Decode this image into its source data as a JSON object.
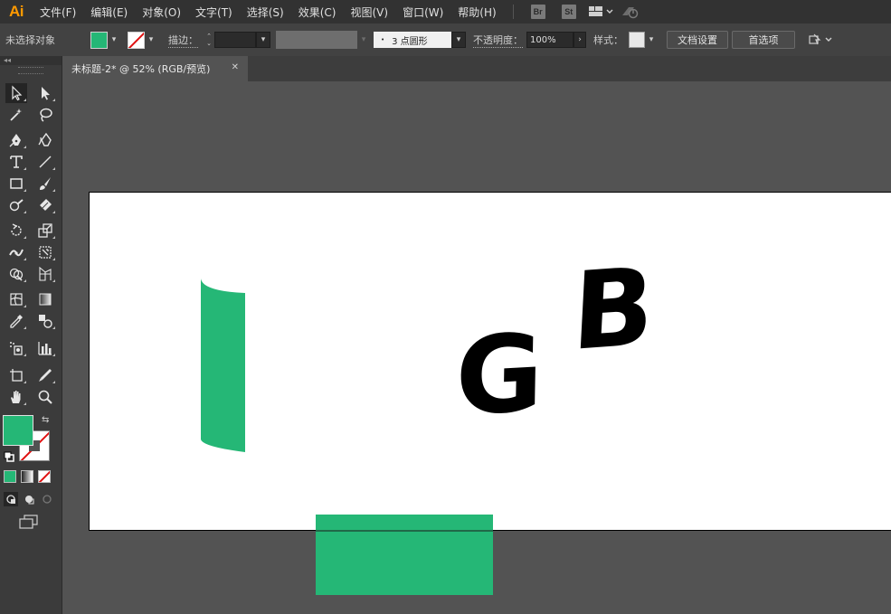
{
  "app": {
    "logo": "Ai"
  },
  "menu": [
    {
      "label": "文件(F)"
    },
    {
      "label": "编辑(E)"
    },
    {
      "label": "对象(O)"
    },
    {
      "label": "文字(T)"
    },
    {
      "label": "选择(S)"
    },
    {
      "label": "效果(C)"
    },
    {
      "label": "视图(V)"
    },
    {
      "label": "窗口(W)"
    },
    {
      "label": "帮助(H)"
    }
  ],
  "menu_apps": {
    "bridge": "Br",
    "stock": "St"
  },
  "control": {
    "selection_status": "未选择对象",
    "stroke_label": "描边：",
    "brush_label": "3 点圆形",
    "opacity_label": "不透明度：",
    "opacity_value": "100%",
    "style_label": "样式：",
    "doc_setup_button": "文档设置",
    "preferences_button": "首选项"
  },
  "document": {
    "tab_title": "未标题-2* @ 52% (RGB/预览)"
  },
  "canvas": {
    "letter_g": "G",
    "letter_b": "B"
  },
  "colors": {
    "accent_fill": "#25b776",
    "stroke": "none"
  }
}
